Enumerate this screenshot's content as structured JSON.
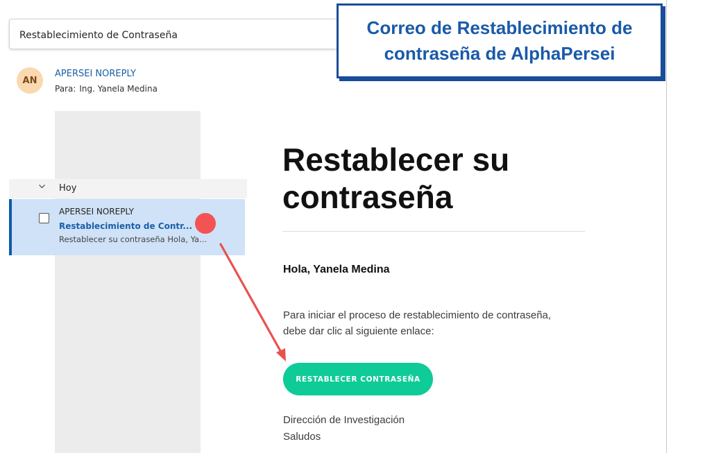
{
  "subject_bar": {
    "title": "Restablecimiento de Contraseña"
  },
  "message_header": {
    "avatar_initials": "AN",
    "sender": "APERSEI NOREPLY",
    "to_label": "Para:",
    "to_name": "Ing. Yanela Medina"
  },
  "email_body": {
    "heading": "Restablecer su contraseña",
    "greeting": "Hola, Yanela Medina",
    "paragraph": "Para iniciar el proceso de restablecimiento de contraseña, debe dar clic al siguiente enlace:",
    "button_label": "RESTABLECER CONTRASEÑA",
    "button_color": "#0ecb97",
    "footer_line1": "Dirección de Investigación",
    "footer_line2": "Saludos"
  },
  "message_list": {
    "group_label": "Hoy",
    "group_icon": "chevron-down-icon",
    "item": {
      "sender": "APERSEI NOREPLY",
      "subject": "Restablecimiento de Contr...",
      "preview": "Restablecer su contraseña Hola, Ya..."
    }
  },
  "callout": {
    "text": "Correo de Restablecimiento de contraseña de AlphaPersei",
    "accent_color": "#1a4d99"
  },
  "annotation": {
    "arrow_color": "#e8524f"
  }
}
